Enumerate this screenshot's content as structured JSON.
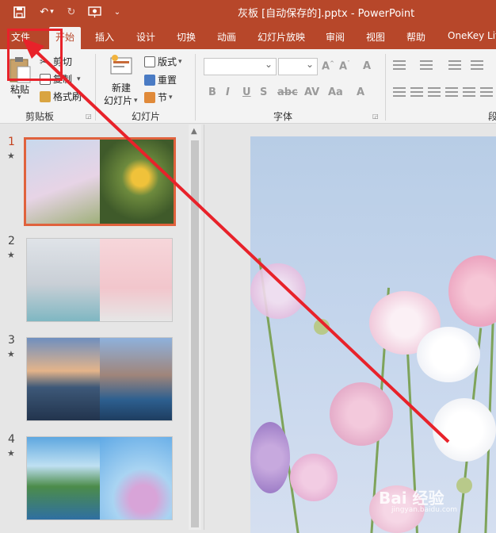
{
  "window": {
    "title": "灰板 [自动保存的].pptx  -  PowerPoint"
  },
  "tabs": [
    {
      "label": "文件",
      "active": false
    },
    {
      "label": "开始",
      "active": true
    },
    {
      "label": "插入",
      "active": false
    },
    {
      "label": "设计",
      "active": false
    },
    {
      "label": "切换",
      "active": false
    },
    {
      "label": "动画",
      "active": false
    },
    {
      "label": "幻灯片放映",
      "active": false
    },
    {
      "label": "审阅",
      "active": false
    },
    {
      "label": "视图",
      "active": false
    },
    {
      "label": "帮助",
      "active": false
    },
    {
      "label": "OneKey Lit",
      "active": false
    }
  ],
  "clipboard": {
    "paste_label": "粘贴",
    "cut_label": "剪切",
    "copy_label": "复制",
    "format_painter_label": "格式刷",
    "group_label": "剪贴板"
  },
  "slides_group": {
    "new_slide_label_line1": "新建",
    "new_slide_label_line2": "幻灯片",
    "layout_label": "版式",
    "reset_label": "重置",
    "section_label": "节",
    "group_label": "幻灯片"
  },
  "font_group": {
    "group_label": "字体",
    "font_name": "",
    "font_size": ""
  },
  "paragraph_group": {
    "group_label": "段"
  },
  "thumbnails": [
    {
      "number": "1",
      "star": "★"
    },
    {
      "number": "2",
      "star": "★"
    },
    {
      "number": "3",
      "star": "★"
    },
    {
      "number": "4",
      "star": "★"
    }
  ],
  "watermark": {
    "text": "Bai 经验",
    "sub": "jingyan.baidu.com"
  },
  "colors": {
    "accent": "#b7472a",
    "highlight": "#e8222a",
    "selection": "#e0623d"
  }
}
